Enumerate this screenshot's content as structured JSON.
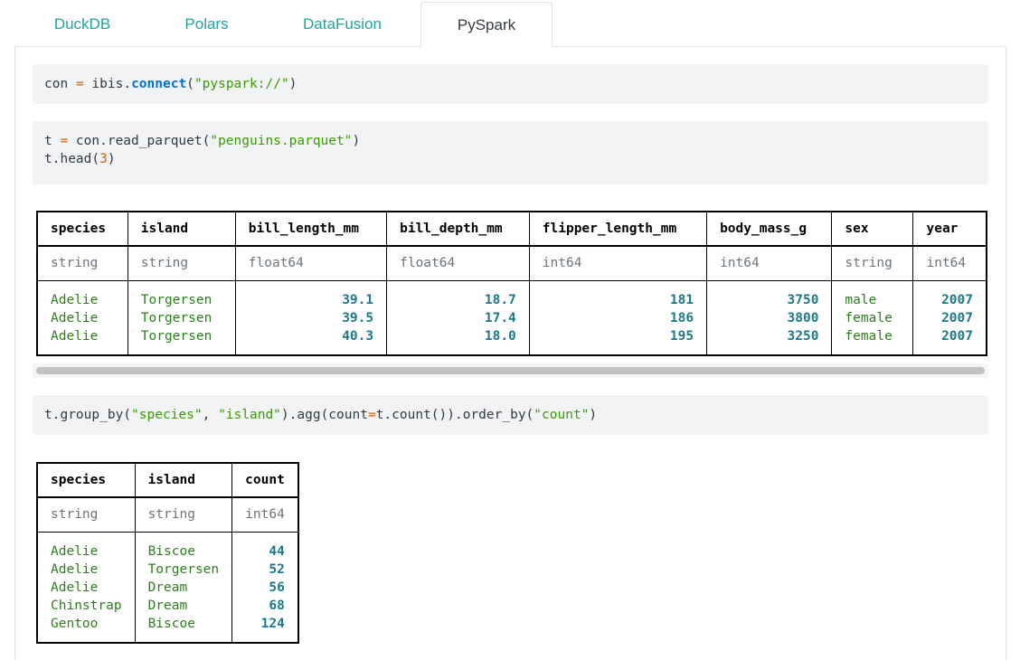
{
  "tabs": [
    {
      "label": "DuckDB",
      "active": false
    },
    {
      "label": "Polars",
      "active": false
    },
    {
      "label": "DataFusion",
      "active": false
    },
    {
      "label": "PySpark",
      "active": true
    }
  ],
  "cells": {
    "connect": {
      "var": "con",
      "op": "=",
      "fn_prefix": "ibis.",
      "fn": "connect",
      "arg": "\"pyspark://\""
    },
    "read": {
      "line1_prefix": "t ",
      "op": "=",
      "line1_call": " con.read_parquet(",
      "line1_arg": "\"penguins.parquet\"",
      "line1_close": ")",
      "line2_prefix": "t.head(",
      "line2_arg": "3",
      "line2_close": ")"
    },
    "group": {
      "p1": "t.group_by(",
      "a1": "\"species\"",
      "p2": ", ",
      "a2": "\"island\"",
      "p3": ").agg(count",
      "op": "=",
      "p4": "t.count()).order_by(",
      "a3": "\"count\"",
      "p5": ")"
    }
  },
  "head_table": {
    "columns": [
      "species",
      "island",
      "bill_length_mm",
      "bill_depth_mm",
      "flipper_length_mm",
      "body_mass_g",
      "sex",
      "year"
    ],
    "types": [
      "string",
      "string",
      "float64",
      "float64",
      "int64",
      "int64",
      "string",
      "int64"
    ],
    "rows": [
      [
        "Adelie",
        "Torgersen",
        "39.1",
        "18.7",
        "181",
        "3750",
        "male",
        "2007"
      ],
      [
        "Adelie",
        "Torgersen",
        "39.5",
        "17.4",
        "186",
        "3800",
        "female",
        "2007"
      ],
      [
        "Adelie",
        "Torgersen",
        "40.3",
        "18.0",
        "195",
        "3250",
        "female",
        "2007"
      ]
    ]
  },
  "count_table": {
    "columns": [
      "species",
      "island",
      "count"
    ],
    "types": [
      "string",
      "string",
      "int64"
    ],
    "rows": [
      [
        "Adelie",
        "Biscoe",
        "44"
      ],
      [
        "Adelie",
        "Torgersen",
        "52"
      ],
      [
        "Adelie",
        "Dream",
        "56"
      ],
      [
        "Chinstrap",
        "Dream",
        "68"
      ],
      [
        "Gentoo",
        "Biscoe",
        "124"
      ]
    ]
  },
  "colors": {
    "accent": "#20a39e",
    "string_value": "#2e7d1e",
    "number_value": "#1a7a89",
    "keyword": "#0073d4",
    "string_literal": "#3b9c00",
    "number_literal": "#d95f02"
  }
}
